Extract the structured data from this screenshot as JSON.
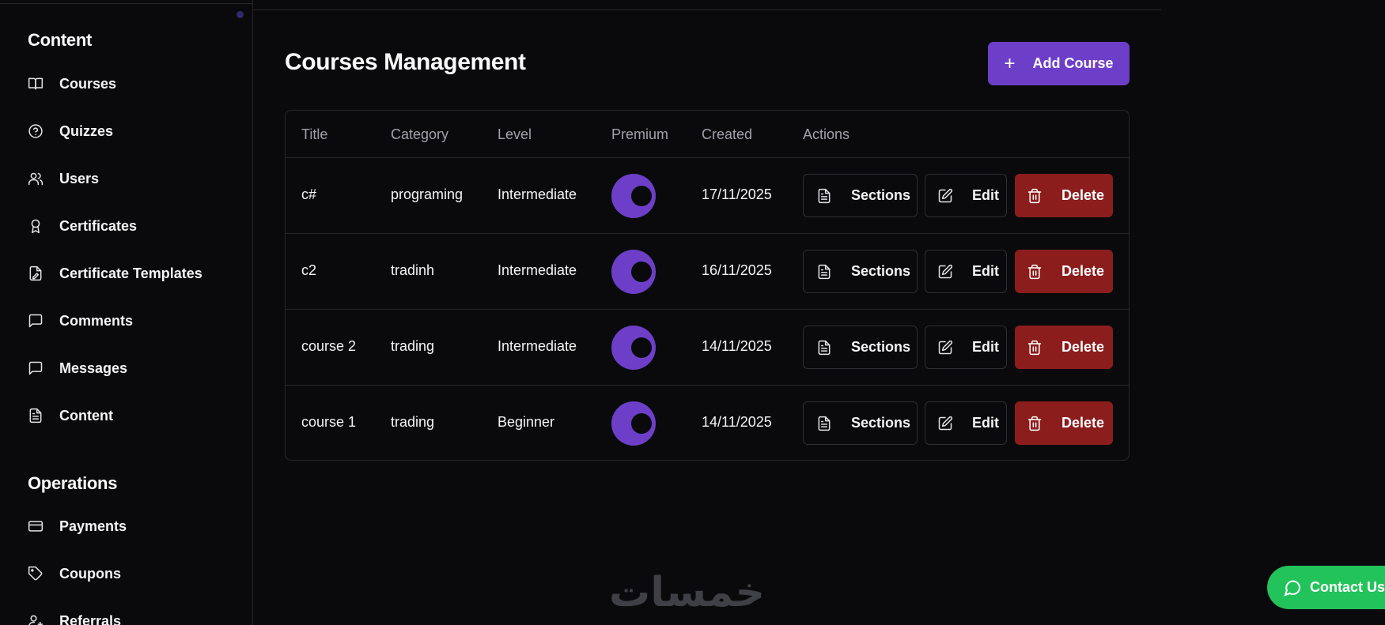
{
  "sidebar": {
    "sections": [
      {
        "title": "Content",
        "items": [
          {
            "label": "Courses",
            "icon": "book-icon"
          },
          {
            "label": "Quizzes",
            "icon": "help-circle-icon"
          },
          {
            "label": "Users",
            "icon": "users-icon"
          },
          {
            "label": "Certificates",
            "icon": "award-icon"
          },
          {
            "label": "Certificate Templates",
            "icon": "file-signature-icon"
          },
          {
            "label": "Comments",
            "icon": "message-square-icon"
          },
          {
            "label": "Messages",
            "icon": "message-square-icon"
          },
          {
            "label": "Content",
            "icon": "file-text-icon"
          }
        ]
      },
      {
        "title": "Operations",
        "items": [
          {
            "label": "Payments",
            "icon": "credit-card-icon"
          },
          {
            "label": "Coupons",
            "icon": "tag-icon"
          },
          {
            "label": "Referrals",
            "icon": "user-plus-icon"
          }
        ]
      }
    ]
  },
  "main": {
    "title": "Courses Management",
    "add_button_label": "Add Course",
    "table": {
      "columns": [
        "Title",
        "Category",
        "Level",
        "Premium",
        "Created",
        "Actions"
      ],
      "rows": [
        {
          "title": "c#",
          "category": "programing",
          "level": "Intermediate",
          "premium": true,
          "created": "17/11/2025"
        },
        {
          "title": "c2",
          "category": "tradinh",
          "level": "Intermediate",
          "premium": true,
          "created": "16/11/2025"
        },
        {
          "title": "course 2",
          "category": "trading",
          "level": "Intermediate",
          "premium": true,
          "created": "14/11/2025"
        },
        {
          "title": "course 1",
          "category": "trading",
          "level": "Beginner",
          "premium": true,
          "created": "14/11/2025"
        }
      ],
      "actions": {
        "sections": "Sections",
        "edit": "Edit",
        "delete": "Delete"
      }
    }
  },
  "watermark": "خمسات",
  "contact_button_label": "Contact Us",
  "colors": {
    "background": "#0a0a0c",
    "accent": "#6d3fc8",
    "danger": "#8b1d1d",
    "contact": "#23c35b",
    "border": "#27272a"
  }
}
